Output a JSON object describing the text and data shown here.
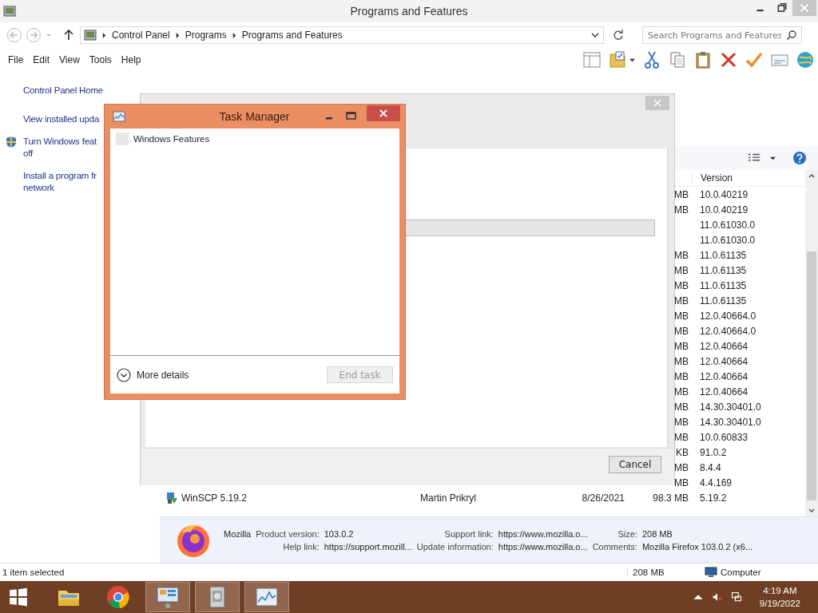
{
  "window": {
    "title": "Programs and Features"
  },
  "address": {
    "crumbs": [
      "Control Panel",
      "Programs",
      "Programs and Features"
    ],
    "search": {
      "placeholder": "Search Programs and Features"
    }
  },
  "menu": [
    "File",
    "Edit",
    "View",
    "Tools",
    "Help"
  ],
  "sidebar": {
    "items": [
      {
        "kind": "link",
        "lines": [
          "Control Panel Home"
        ]
      },
      {
        "kind": "link",
        "lines": [
          "View installed upda"
        ]
      },
      {
        "kind": "shield",
        "lines": [
          "Turn Windows feat",
          "off"
        ]
      },
      {
        "kind": "link",
        "lines": [
          "Install a program fr",
          "network"
        ]
      }
    ]
  },
  "list": {
    "column_header": "Version",
    "rows": [
      {
        "size": "MB",
        "version": "10.0.40219"
      },
      {
        "size": "MB",
        "version": "10.0.40219"
      },
      {
        "version": "11.0.61030.0"
      },
      {
        "version": "11.0.61030.0"
      },
      {
        "size": "MB",
        "version": "11.0.61135"
      },
      {
        "size": "MB",
        "version": "11.0.61135"
      },
      {
        "size": "MB",
        "version": "11.0.61135"
      },
      {
        "size": "MB",
        "version": "11.0.61135"
      },
      {
        "size": "MB",
        "version": "12.0.40664.0"
      },
      {
        "size": "MB",
        "version": "12.0.40664.0"
      },
      {
        "size": "MB",
        "version": "12.0.40664"
      },
      {
        "size": "MB",
        "version": "12.0.40664"
      },
      {
        "size": "MB",
        "version": "12.0.40664"
      },
      {
        "size": "MB",
        "version": "12.0.40664"
      },
      {
        "size": "MB",
        "version": "14.30.30401.0"
      },
      {
        "size": "MB",
        "version": "14.30.30401.0"
      },
      {
        "size": "MB",
        "version": "10.0.60833"
      },
      {
        "size": "KB",
        "version": "91.0.2"
      },
      {
        "size": "MB",
        "version": "8.4.4"
      },
      {
        "size": "MB",
        "version": "4.4.169"
      },
      {
        "name": "WinSCP 5.19.2",
        "publisher": "Martin Prikryl",
        "installed_on": "8/26/2021",
        "size": "98.3 MB",
        "version": "5.19.2"
      }
    ]
  },
  "features_dialog": {
    "progress": {
      "level": 0
    },
    "cancel": "Cancel"
  },
  "task_manager": {
    "title": "Task Manager",
    "apps": [
      {
        "name": "Windows Features"
      }
    ],
    "more_details": "More details",
    "end_task": {
      "label": "End task",
      "disabled": true
    }
  },
  "details": {
    "name": "Mozilla",
    "fields": [
      {
        "label": "Product version:",
        "value": "103.0.2"
      },
      {
        "label": "Support link:",
        "value": "https://www.mozilla.o..."
      },
      {
        "label": "Size:",
        "value": "208 MB"
      },
      {
        "label": "Help link:",
        "value": "https://support.mozill..."
      },
      {
        "label": "Update information:",
        "value": "https://www.mozilla.o..."
      },
      {
        "label": "Comments:",
        "value": "Mozilla Firefox 103.0.2 (x6..."
      }
    ]
  },
  "status_bar": {
    "selection": "1 item selected",
    "size": "208 MB",
    "zone": "Computer"
  },
  "taskbar": {
    "apps": [
      {
        "kind": "explorer",
        "active": false
      },
      {
        "kind": "browser",
        "active": false
      },
      {
        "kind": "control-panel",
        "active": true
      },
      {
        "kind": "installer",
        "active": true
      },
      {
        "kind": "task-manager",
        "active": true
      }
    ],
    "time": "4:19 AM",
    "date": "9/19/2022"
  }
}
